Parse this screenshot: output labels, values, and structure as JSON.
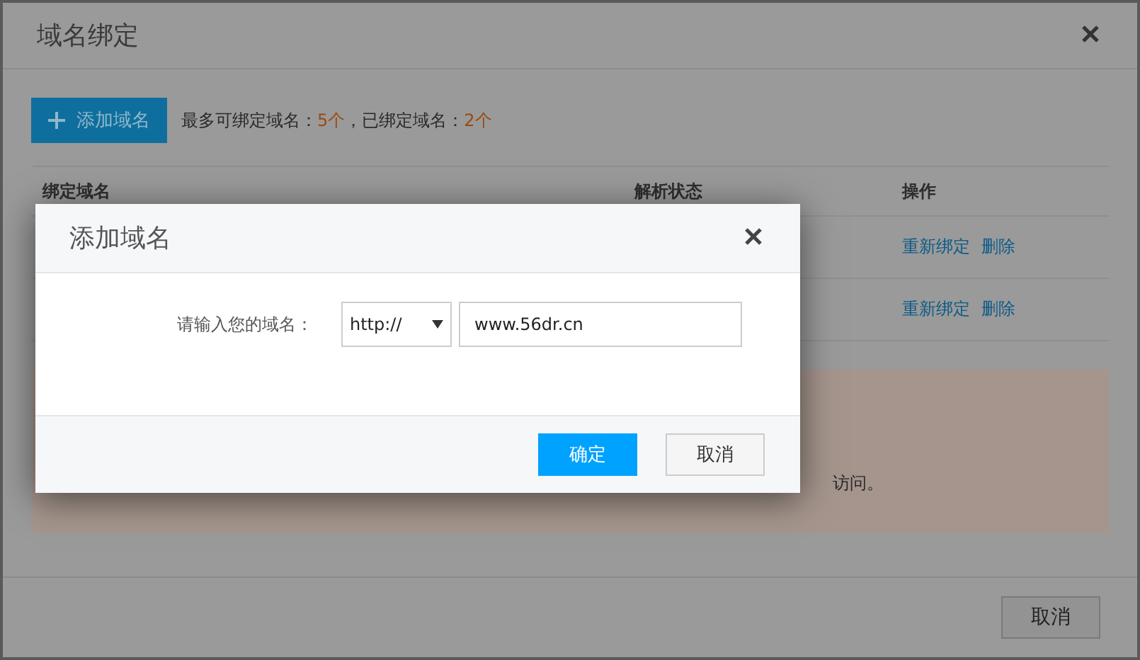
{
  "dialog": {
    "title": "域名绑定",
    "toolbar": {
      "add_button": "添加域名",
      "quota_label": "最多可绑定域名：",
      "quota_max": "5个",
      "separator": "，已绑定域名：",
      "quota_used": "2个"
    },
    "table": {
      "columns": [
        "绑定域名",
        "解析状态",
        "操作"
      ],
      "rows": [
        {
          "actions": [
            "重新绑定",
            "删除"
          ]
        },
        {
          "actions": [
            "重新绑定",
            "删除"
          ]
        }
      ]
    },
    "notice": {
      "text": "访问。"
    },
    "footer": {
      "cancel_button": "取消"
    }
  },
  "modal": {
    "title": "添加域名",
    "field_label": "请输入您的域名：",
    "protocol_select": "http://",
    "domain_input": "www.56dr.cn",
    "confirm_button": "确定",
    "cancel_button": "取消"
  }
}
